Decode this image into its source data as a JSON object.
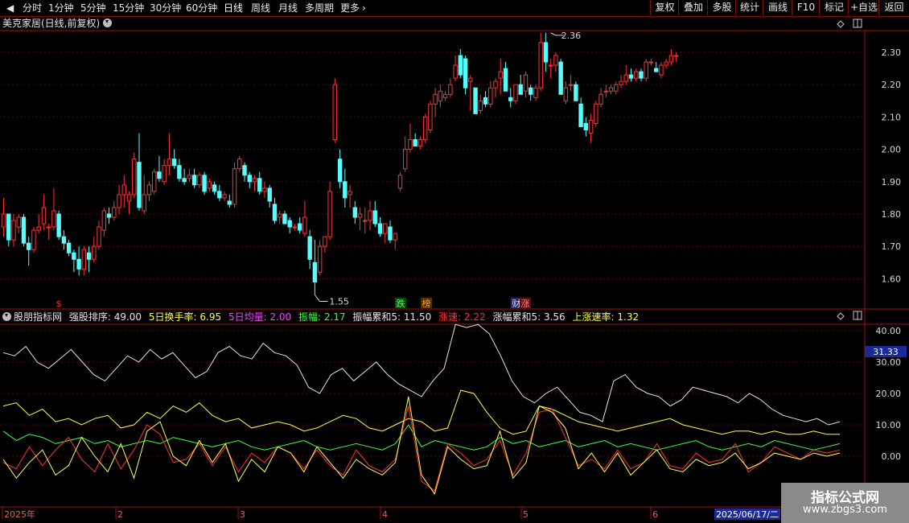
{
  "toolbar": {
    "periods": [
      {
        "label": "分时"
      },
      {
        "label": "1分钟"
      },
      {
        "label": "5分钟"
      },
      {
        "label": "15分钟"
      },
      {
        "label": "30分钟"
      },
      {
        "label": "60分钟"
      },
      {
        "label": "日线",
        "active": true
      },
      {
        "label": "周线"
      },
      {
        "label": "月线"
      },
      {
        "label": "多周期"
      },
      {
        "label": "更多"
      }
    ],
    "more_arrow": "›",
    "buttons": [
      {
        "label": "复权"
      },
      {
        "label": "叠加"
      },
      {
        "label": "多股"
      },
      {
        "label": "统计"
      },
      {
        "label": "画线"
      },
      {
        "label": "F10"
      },
      {
        "label": "标记"
      },
      {
        "label": "+自选"
      },
      {
        "label": "返回"
      }
    ]
  },
  "stock": {
    "title": "美克家居(日线,前复权)"
  },
  "price_axis": {
    "labels": [
      "2.30",
      "2.20",
      "2.10",
      "2.00",
      "1.90",
      "1.80",
      "1.70",
      "1.60"
    ]
  },
  "price_annotations": {
    "high": "2.36",
    "low": "1.55"
  },
  "markers": [
    {
      "text": "$",
      "color": "#ff3030"
    },
    {
      "text": "跌",
      "color": "#50ff50",
      "bg": "#0a4a0a"
    },
    {
      "text": "榜",
      "color": "#ff9a30",
      "bg": "#503000"
    },
    {
      "text": "财",
      "color": "#d0d0ff",
      "bg": "#2a2a6a"
    },
    {
      "text": "涨",
      "color": "#ff8080",
      "bg": "#5a1010"
    }
  ],
  "indicator": {
    "name": "股朋指标网",
    "items": [
      {
        "label": "强股排序: 49.00",
        "color": "#e6e6e6"
      },
      {
        "label": "5日换手率: 6.95",
        "color": "#ffff40"
      },
      {
        "label": "5日均量: 2.00",
        "color": "#ff40ff"
      },
      {
        "label": "振幅: 2.17",
        "color": "#40ff40"
      },
      {
        "label": "振幅累和5: 11.50",
        "color": "#e6e6e6"
      },
      {
        "label": "涨速: 2.22",
        "color": "#ff3030"
      },
      {
        "label": "涨幅累和5: 3.56",
        "color": "#e6e6e6"
      },
      {
        "label": "上涨速率: 1.32",
        "color": "#ffff40"
      }
    ],
    "axis_labels": [
      "40.00",
      "30.00",
      "20.00",
      "10.00",
      "0.00"
    ],
    "current_value": "31.33"
  },
  "date_axis": {
    "labels": [
      "2025年",
      "2",
      "3",
      "4",
      "5",
      "6"
    ],
    "cursor_date": "2025/06/17/二"
  },
  "colors": {
    "up": "#ff3232",
    "down": "#54ffff",
    "grid": "#6a0000",
    "border": "#a01010",
    "axis_text": "#d8d8d8"
  },
  "watermark": {
    "title": "指标公式网",
    "url": "www.zbgs3.com"
  }
}
